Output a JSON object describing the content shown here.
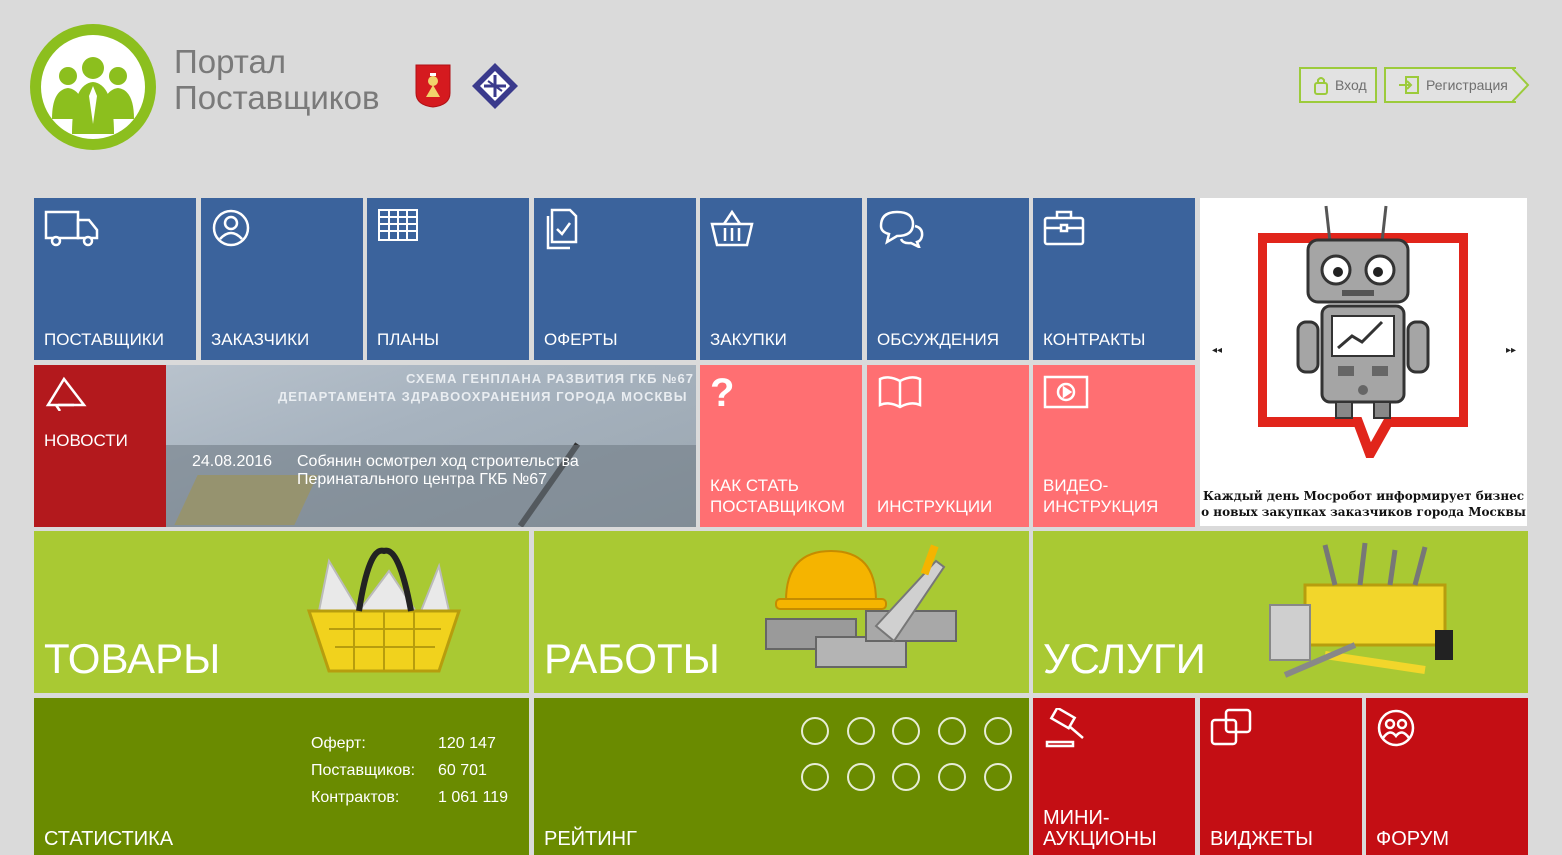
{
  "header": {
    "logo_line1": "Портал",
    "logo_line2": "Поставщиков",
    "login_label": "Вход",
    "register_label": "Регистрация"
  },
  "tiles_top": [
    {
      "label": "ПОСТАВЩИКИ",
      "icon": "truck-icon"
    },
    {
      "label": "ЗАКАЗЧИКИ",
      "icon": "user-icon"
    },
    {
      "label": "ПЛАНЫ",
      "icon": "table-icon"
    },
    {
      "label": "ОФЕРТЫ",
      "icon": "document-check-icon"
    },
    {
      "label": "ЗАКУПКИ",
      "icon": "basket-icon"
    },
    {
      "label": "ОБСУЖДЕНИЯ",
      "icon": "chat-icon"
    },
    {
      "label": "КОНТРАКТЫ",
      "icon": "briefcase-icon"
    }
  ],
  "news": {
    "label": "НОВОСТИ",
    "date": "24.08.2016",
    "title": "Собянин осмотрел ход строительства Перинатального центра ГКБ №67",
    "photo_caption_line1": "СХЕМА ГЕНПЛАНА РАЗВИТИЯ ГКБ №67",
    "photo_caption_line2": "ДЕПАРТАМЕНТА ЗДРАВООХРАНЕНИЯ ГОРОДА МОСКВЫ"
  },
  "tiles_mid": [
    {
      "label": "КАК СТАТЬ ПОСТАВЩИКОМ",
      "icon": "question-icon"
    },
    {
      "label": "ИНСТРУКЦИИ",
      "icon": "book-icon"
    },
    {
      "label": "ВИДЕО-ИНСТРУКЦИЯ",
      "icon": "video-play-icon"
    }
  ],
  "banner": {
    "text": "Каждый день Мосробот информирует бизнес о новых закупках заказчиков города Москвы",
    "prev": "◂◂",
    "next": "▸▸"
  },
  "categories": [
    {
      "label": "ТОВАРЫ",
      "image": "basket-goods-image"
    },
    {
      "label": "РАБОТЫ",
      "image": "construction-helmet-bricks-image"
    },
    {
      "label": "УСЛУГИ",
      "image": "toolbox-image"
    }
  ],
  "statistics": {
    "label": "СТАТИСТИКА",
    "rows": [
      {
        "key": "Оферт:",
        "value": "120 147"
      },
      {
        "key": "Поставщиков:",
        "value": "60 701"
      },
      {
        "key": "Контрактов:",
        "value": "1 061 119"
      }
    ]
  },
  "rating": {
    "label": "РЕЙТИНГ",
    "icons": [
      "award-icon",
      "search-document-icon",
      "bar-chart-icon",
      "table-icon",
      "tools-icon",
      "document-icon",
      "person-icon",
      "briefcase-icon",
      "star-icon",
      "id-card-icon"
    ]
  },
  "tiles_bottom": [
    {
      "label": "МИНИ-АУКЦИОНЫ",
      "icon": "gavel-icon"
    },
    {
      "label": "ВИДЖЕТЫ",
      "icon": "widgets-icon"
    },
    {
      "label": "ФОРУМ",
      "icon": "forum-people-icon"
    }
  ],
  "colors": {
    "blue": "#3b639c",
    "pink": "#ff6f72",
    "darkred": "#b3191d",
    "lime": "#a9c933",
    "olive": "#6a8b00",
    "red": "#c40e14",
    "logo_green": "#8cbf1e"
  }
}
